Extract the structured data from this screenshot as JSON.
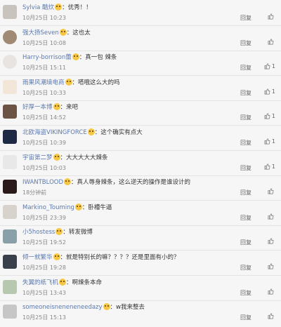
{
  "reply_label": "回复",
  "comments": [
    {
      "user": "Sylvia 酷炊",
      "text": "：优秀！！",
      "time": "10月25日 10:23",
      "likes": "",
      "avatar_color": "#c9c3bd"
    },
    {
      "user": "强大扬Seven",
      "text": "：这也太",
      "time": "10月25日 10:08",
      "likes": "",
      "avatar_color": "#a08a76"
    },
    {
      "user": "Harry-borrison蕾",
      "text": "：真一包 辣条",
      "time": "10月25日 15:11",
      "likes": "1",
      "avatar_color": "#e9e4e0"
    },
    {
      "user": "雨果风潮境电商",
      "text": "：嗒哦这么大的吗",
      "time": "10月25日 10:33",
      "likes": "1",
      "avatar_color": "#f2e6d8"
    },
    {
      "user": "好厚一本博",
      "text": "：来吧",
      "time": "10月25日 14:52",
      "likes": "1",
      "avatar_color": "#6b5446"
    },
    {
      "user": "北欧海盗VIKINGFORCE",
      "text": "：这个确实有点大",
      "time": "10月25日 10:39",
      "likes": "1",
      "avatar_color": "#1e2a44"
    },
    {
      "user": "宇宙第二梦",
      "text": "：大大大大大辣条",
      "time": "10月25日 10:03",
      "likes": "1",
      "avatar_color": "#e8e8e8"
    },
    {
      "user": "IWANTBLOOD",
      "text": "：真人辱身辣条，这么逆天的操作是谁设计的",
      "time": "18分钟前",
      "likes": "",
      "avatar_color": "#2a1a1a"
    },
    {
      "user": "Markino_Touming",
      "text": "：卧槽牛逼",
      "time": "10月25日 23:39",
      "likes": "",
      "avatar_color": "#d8d2cc"
    },
    {
      "user": "小5hostess",
      "text": "：转发微博",
      "time": "10月25日 19:52",
      "likes": "",
      "avatar_color": "#8aa0a8"
    },
    {
      "user": "倾一就繁华",
      "text": "：就是特别长的嘛？？？？还是里面有小的？",
      "time": "10月25日 19:28",
      "likes": "",
      "avatar_color": "#3a3f4c"
    },
    {
      "user": "失翼的纸飞机",
      "text": "：啊辣条本命",
      "time": "10月25日 13:43",
      "likes": "",
      "avatar_color": "#b7c8b0"
    },
    {
      "user": "someoneisneneneneedazy",
      "text": "：w我来整去",
      "time": "10月25日 15:13",
      "likes": "",
      "avatar_color": "#c6c6c6"
    }
  ]
}
